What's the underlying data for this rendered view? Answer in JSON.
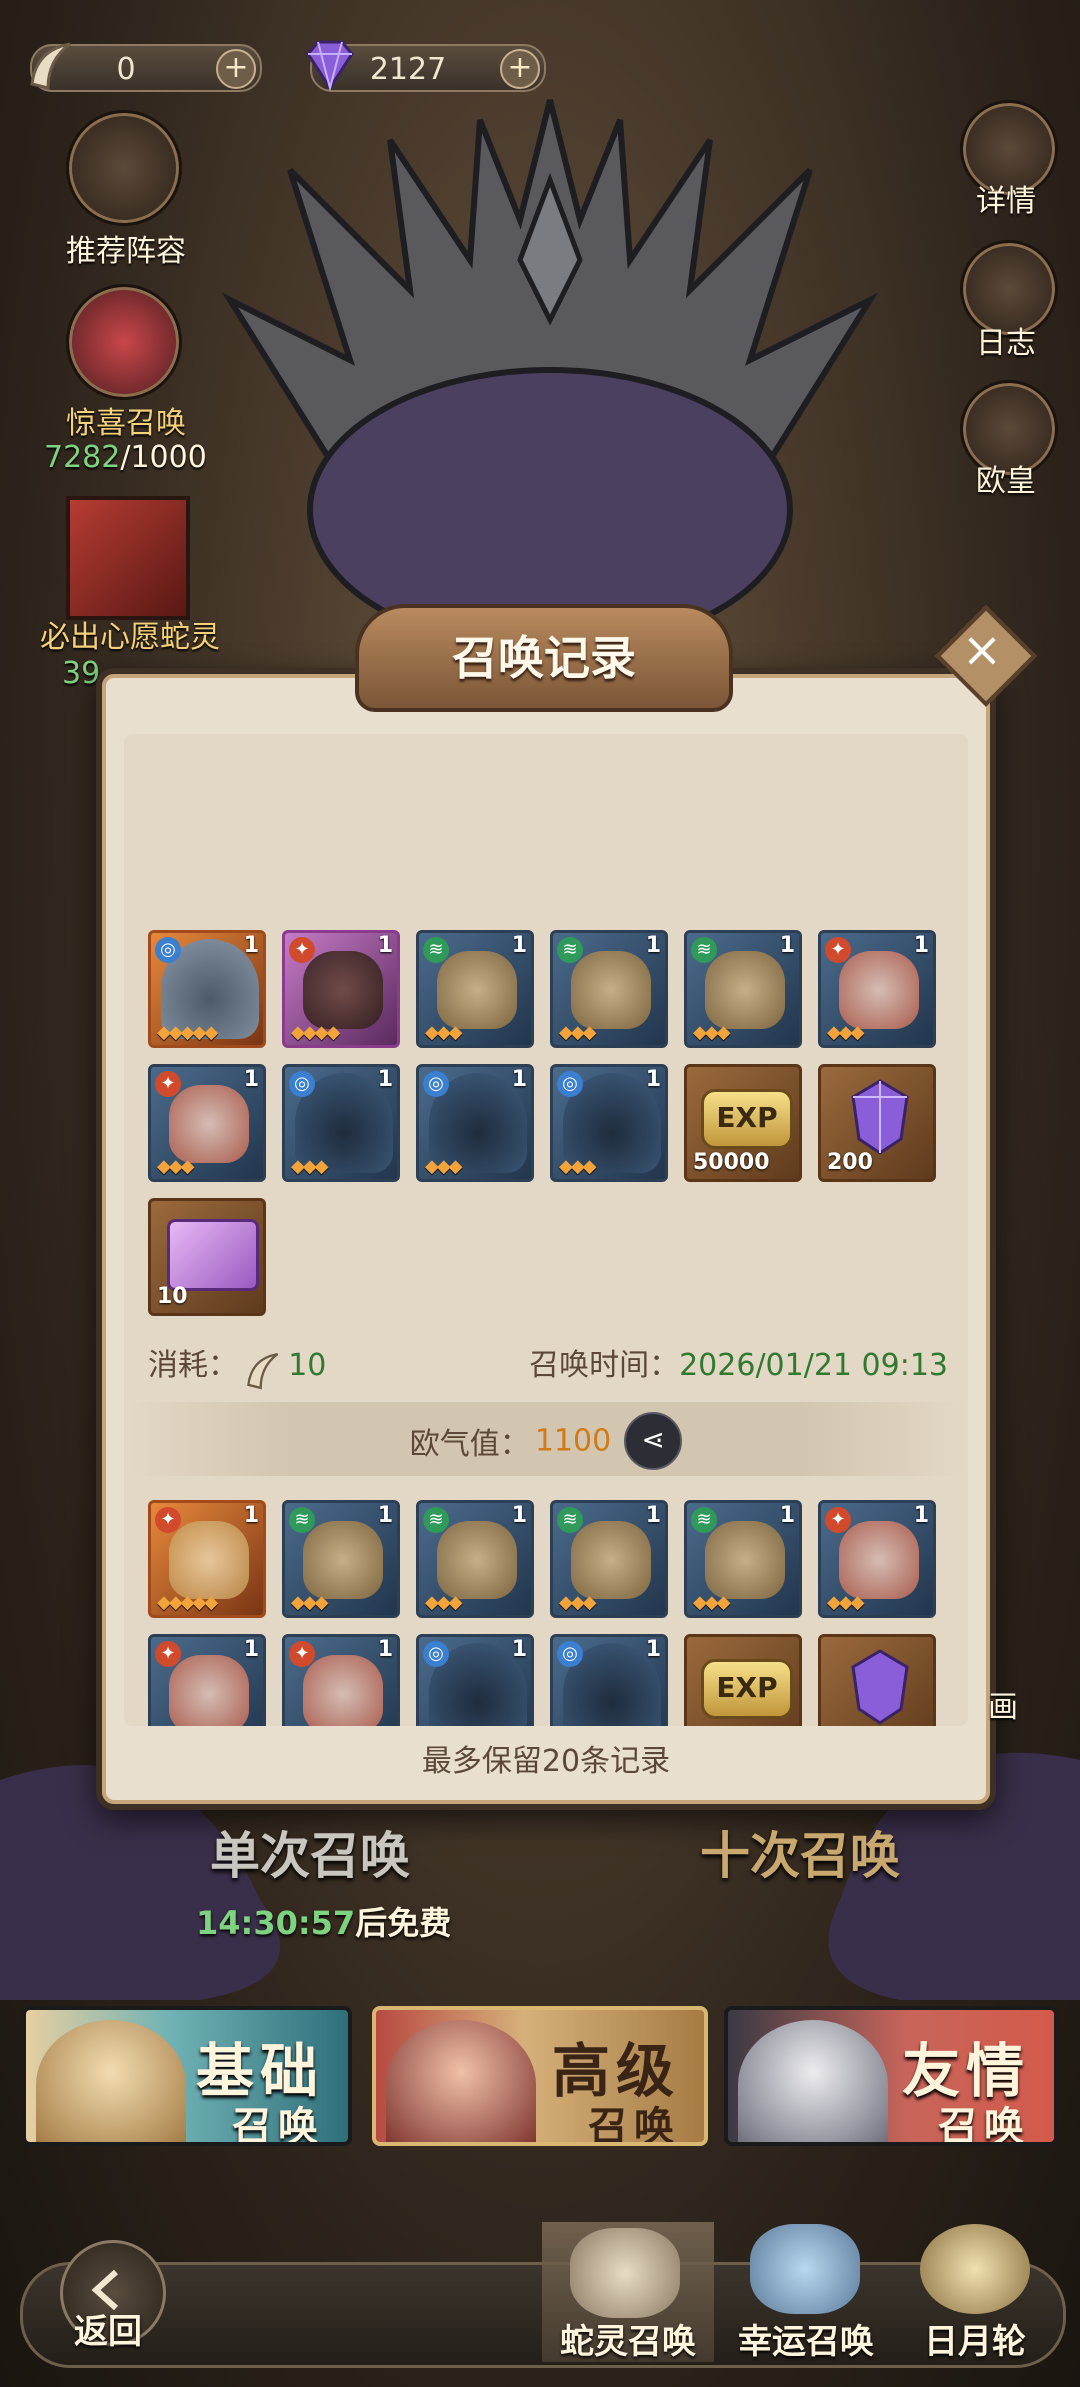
{
  "currency": {
    "claws": "0",
    "gems": "2127"
  },
  "left_menu": {
    "recommend": "推荐阵容",
    "surprise": "惊喜召唤",
    "surprise_progress_current": "7282",
    "surprise_progress_total": "/1000",
    "wish": "必出心愿蛇灵",
    "wish_progress": "39"
  },
  "right_menu": {
    "details": "详情",
    "log": "日志",
    "emperor": "欧皇"
  },
  "modal": {
    "title": "召唤记录",
    "record1": {
      "cost_label": "消耗：",
      "cost_value": "10",
      "time_label": "召唤时间：",
      "time_value": "2026/01/21 09:13",
      "luck_label": "欧气值：",
      "luck_value": "1100",
      "row1": [
        {
          "frame": "orange",
          "element": "water",
          "count": "1"
        },
        {
          "frame": "purple",
          "element": "fire",
          "count": "1"
        },
        {
          "frame": "blue",
          "element": "wind",
          "count": "1"
        },
        {
          "frame": "blue",
          "element": "wind",
          "count": "1"
        },
        {
          "frame": "blue",
          "element": "wind",
          "count": "1"
        },
        {
          "frame": "blue",
          "element": "fire",
          "count": "1"
        }
      ],
      "row2": [
        {
          "frame": "blue",
          "element": "fire",
          "count": "1"
        },
        {
          "frame": "blue",
          "element": "water",
          "count": "1"
        },
        {
          "frame": "blue",
          "element": "water",
          "count": "1"
        },
        {
          "frame": "blue",
          "element": "water",
          "count": "1"
        }
      ],
      "items": [
        {
          "name": "EXP",
          "qty": "50000"
        },
        {
          "name": "crystal",
          "qty": "200"
        },
        {
          "name": "card",
          "qty": "10"
        }
      ]
    },
    "record2": {
      "row1_counts": [
        "1",
        "1",
        "1",
        "1",
        "1",
        "1"
      ],
      "row2_counts": [
        "1",
        "1",
        "1",
        "1"
      ],
      "item_label": "EXP"
    },
    "footer": "最多保留20条记录"
  },
  "summon": {
    "single": "单次召唤",
    "ten": "十次召唤",
    "free_timer": "14:30:57",
    "free_suffix": "后免费",
    "side_text": "画"
  },
  "tabs": {
    "basic_title": "基础",
    "basic_sub": "召唤",
    "advanced_title": "高级",
    "advanced_sub": "召唤",
    "friend_title": "友情",
    "friend_sub": "召唤"
  },
  "nav": {
    "back": "返回",
    "snake": "蛇灵召唤",
    "lucky": "幸运召唤",
    "sunmoon": "日月轮"
  },
  "colors": {
    "accent_orange": "#d07a18",
    "text_green": "#2f7a2f",
    "modal_bg": "#e9dfcf"
  }
}
